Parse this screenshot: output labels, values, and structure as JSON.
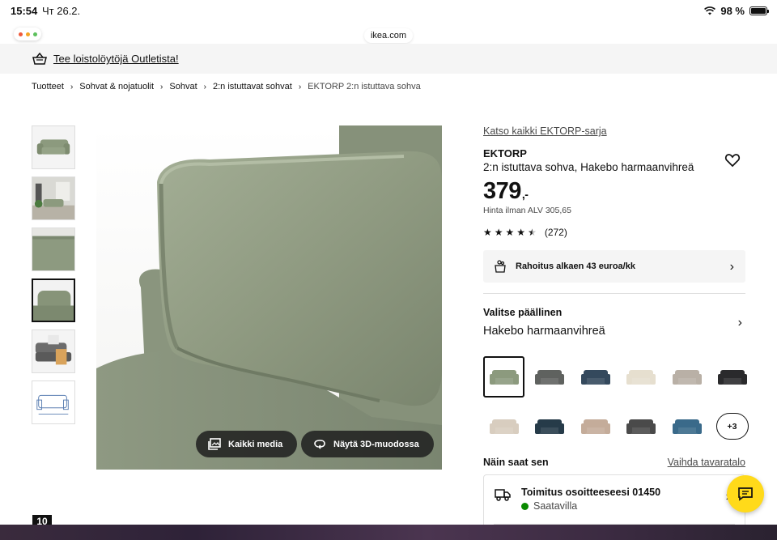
{
  "statusbar": {
    "time": "15:54",
    "date": "Чт 26.2.",
    "battery": "98 %"
  },
  "browser": {
    "url": "ikea.com"
  },
  "promo": {
    "text": "Tee loistolöytöjä Outletista!"
  },
  "breadcrumb": {
    "items": [
      "Tuotteet",
      "Sohvat & nojatuolit",
      "Sohvat",
      "2:n istuttavat sohvat"
    ],
    "current": "EKTORP 2:n istuttava sohva"
  },
  "gallery": {
    "all_media_label": "Kaikki media",
    "view_3d_label": "Näytä 3D-muodossa",
    "page_number": "10"
  },
  "product": {
    "series_link": "Katso kaikki EKTORP-sarja",
    "name": "EKTORP",
    "description": "2:n istuttava sohva, Hakebo harmaanvihreä",
    "price": "379",
    "price_suffix": ",-",
    "price_ex_vat": "Hinta ilman ALV 305,65",
    "rating_stars": 4.5,
    "review_count": "(272)"
  },
  "financing": {
    "label": "Rahoitus alkaen 43 euroa/kk"
  },
  "cover": {
    "title": "Valitse päällinen",
    "selected": "Hakebo harmaanvihreä",
    "more_label": "+3",
    "swatch_colors": [
      "#8c9a7e",
      "#5f625f",
      "#34495d",
      "#e6dfcf",
      "#b9b0a6",
      "#2a2a2c",
      "#d8cdbf",
      "#263b49",
      "#c4ac9a",
      "#4a4a4a",
      "#3a6a8a"
    ]
  },
  "delivery": {
    "title": "Näin saat sen",
    "change_store": "Vaihda tavaratalo",
    "option_title": "Toimitus osoitteeseesi 01450",
    "option_status": "Saatavilla"
  },
  "colors": {
    "accent_yellow": "#ffda1a",
    "available_green": "#0a8a00"
  }
}
